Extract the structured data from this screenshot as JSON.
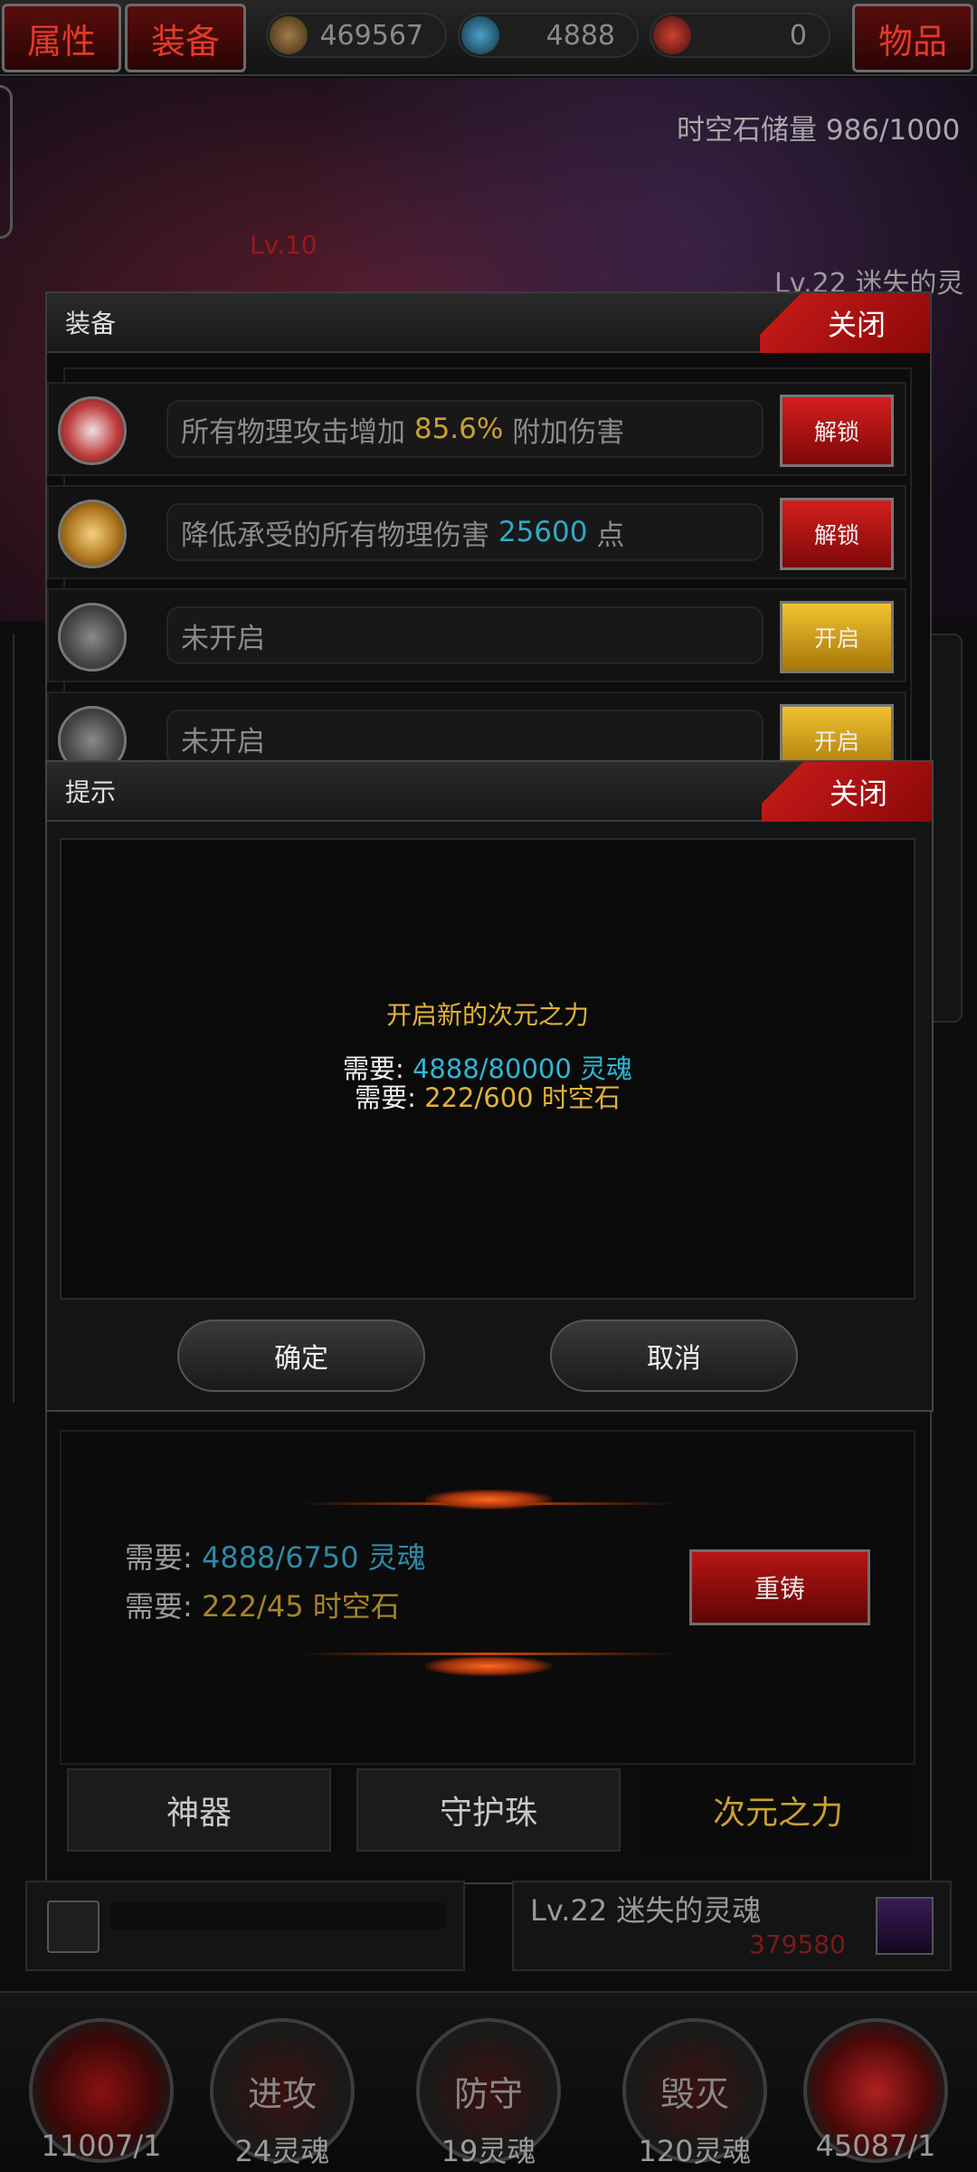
{
  "top_bar": {
    "attr_tab": "属性",
    "equip_tab": "装备",
    "items_tab": "物品",
    "resource_1": "469567",
    "resource_2": "4888",
    "resource_3": "0"
  },
  "scene": {
    "stone_capacity": "时空石储量 986/1000",
    "enemy_label": "Lv.22 迷失的灵魂",
    "small_level": "Lv.10"
  },
  "equip_panel": {
    "title": "装备",
    "close_label": "关闭",
    "rows": [
      {
        "prefix": "所有物理攻击增加 ",
        "value": "85.6%",
        "suffix": " 附加伤害",
        "value_color": "#c9a032",
        "button": "解锁",
        "button_type": "red",
        "icon": "shield-emblem-icon"
      },
      {
        "prefix": "降低承受的所有物理伤害 ",
        "value": "25600",
        "suffix": " 点",
        "value_color": "#2fa9c4",
        "button": "解锁",
        "button_type": "red",
        "icon": "gold-orb-icon"
      },
      {
        "prefix": "未开启",
        "value": "",
        "suffix": "",
        "value_color": "",
        "button": "开启",
        "button_type": "gold",
        "icon": "hexagram-icon"
      },
      {
        "prefix": "未开启",
        "value": "",
        "suffix": "",
        "value_color": "",
        "button": "开启",
        "button_type": "gold",
        "icon": "hexagram-icon"
      }
    ]
  },
  "prompt": {
    "title": "提示",
    "close_label": "关闭",
    "heading": "开启新的次元之力",
    "need_label": "需要: ",
    "soul_req": "4888/80000 灵魂",
    "stone_req": "222/600 时空石",
    "confirm": "确定",
    "cancel": "取消"
  },
  "reforge": {
    "need_label": "需要: ",
    "soul_req": "4888/6750 灵魂",
    "stone_req": "222/45 时空石",
    "button": "重铸"
  },
  "tabs": [
    "神器",
    "守护珠",
    "次元之力"
  ],
  "status_bar": {
    "enemy_name": "Lv.22 迷失的灵魂",
    "enemy_hp": "379580"
  },
  "bottom": [
    {
      "label": "",
      "sub": "11007/1"
    },
    {
      "label": "进攻",
      "sub": "24灵魂"
    },
    {
      "label": "防守",
      "sub": "19灵魂"
    },
    {
      "label": "毁灭",
      "sub": "120灵魂"
    },
    {
      "label": "",
      "sub": "45087/1"
    }
  ],
  "colors": {
    "gold": "#c9a032",
    "cyan": "#2fa9c4",
    "red": "#c01818"
  }
}
